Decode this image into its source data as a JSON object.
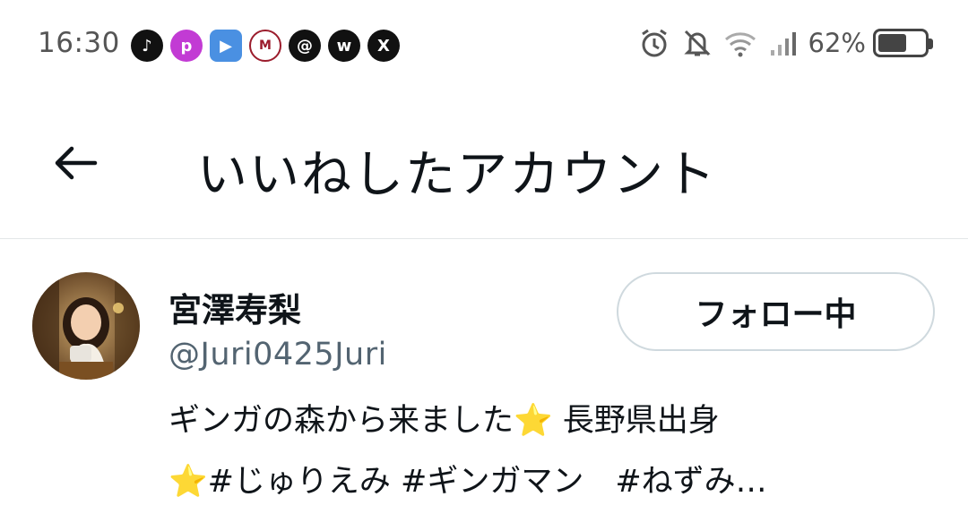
{
  "status_bar": {
    "time": "16:30",
    "app_icons": [
      {
        "name": "tiktok-icon",
        "glyph": "♪"
      },
      {
        "name": "pixiv-icon",
        "glyph": "p"
      },
      {
        "name": "youtube-icon",
        "glyph": "▶"
      },
      {
        "name": "mobile-app-icon",
        "glyph": "M"
      },
      {
        "name": "threads-icon",
        "glyph": "@"
      },
      {
        "name": "weverse-icon",
        "glyph": "w"
      },
      {
        "name": "x-icon",
        "glyph": "X"
      }
    ],
    "battery_percent": "62%",
    "battery_level": 0.62
  },
  "header": {
    "title": "いいねしたアカウント"
  },
  "user": {
    "name": "宮澤寿梨",
    "handle": "@Juri0425Juri",
    "follow_label": "フォロー中",
    "bio_line1": "ギンガの森から来ました⭐ 長野県出身",
    "bio_line2": "⭐#じゅりえみ #ギンガマン　#ねずみ…"
  },
  "colors": {
    "text_primary": "#0f1419",
    "text_secondary": "#536471",
    "border": "#cfd9de"
  }
}
